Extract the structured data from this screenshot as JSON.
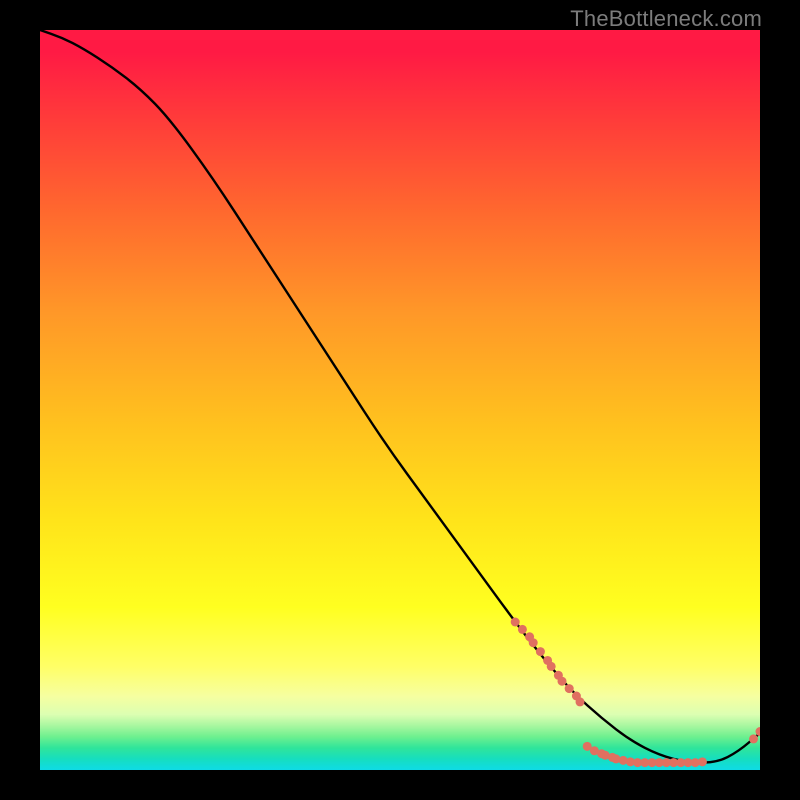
{
  "watermark": "TheBottleneck.com",
  "chart_data": {
    "type": "line",
    "title": "",
    "xlabel": "",
    "ylabel": "",
    "x_range": [
      0,
      100
    ],
    "y_range": [
      0,
      100
    ],
    "grid": false,
    "legend": false,
    "series": [
      {
        "name": "curve",
        "color": "#000000",
        "x": [
          0,
          3,
          6,
          10,
          14,
          18,
          24,
          30,
          36,
          42,
          48,
          54,
          60,
          66,
          70,
          74,
          78,
          82,
          86,
          90,
          94,
          97,
          100
        ],
        "y": [
          100,
          99,
          97.5,
          95,
          92,
          88,
          80,
          71,
          62,
          53,
          44,
          36,
          28,
          20,
          15,
          10.5,
          7,
          4,
          2,
          1,
          1,
          2.5,
          5
        ]
      }
    ],
    "markers": {
      "name": "dots",
      "color": "#e07060",
      "radius_px": 4.5,
      "clusters": [
        {
          "x": [
            66,
            67,
            68,
            68.5,
            69.5,
            70.5,
            71,
            72,
            72.5,
            73.5,
            74.5,
            75
          ],
          "y": [
            20,
            19,
            18,
            17.2,
            16,
            14.8,
            14,
            12.8,
            12,
            11,
            10,
            9.2
          ]
        },
        {
          "x": [
            76,
            77,
            78,
            78.5,
            79.5,
            80,
            81,
            82,
            83,
            84,
            85,
            86,
            87,
            88,
            89,
            90,
            91,
            92
          ],
          "y": [
            3.2,
            2.6,
            2.2,
            2.0,
            1.7,
            1.5,
            1.3,
            1.1,
            1.0,
            1.0,
            1.0,
            1.0,
            1.0,
            1.0,
            1.0,
            1.0,
            1.0,
            1.1
          ]
        },
        {
          "x": [
            99.1,
            100
          ],
          "y": [
            4.2,
            5.2
          ]
        }
      ]
    },
    "gradient_stops": [
      {
        "pos": 0.0,
        "color": "#ff1a44"
      },
      {
        "pos": 0.25,
        "color": "#ff6a2e"
      },
      {
        "pos": 0.52,
        "color": "#ffbe1f"
      },
      {
        "pos": 0.78,
        "color": "#ffff20"
      },
      {
        "pos": 0.94,
        "color": "#a9f7a0"
      },
      {
        "pos": 1.0,
        "color": "#0fdbe6"
      }
    ]
  }
}
